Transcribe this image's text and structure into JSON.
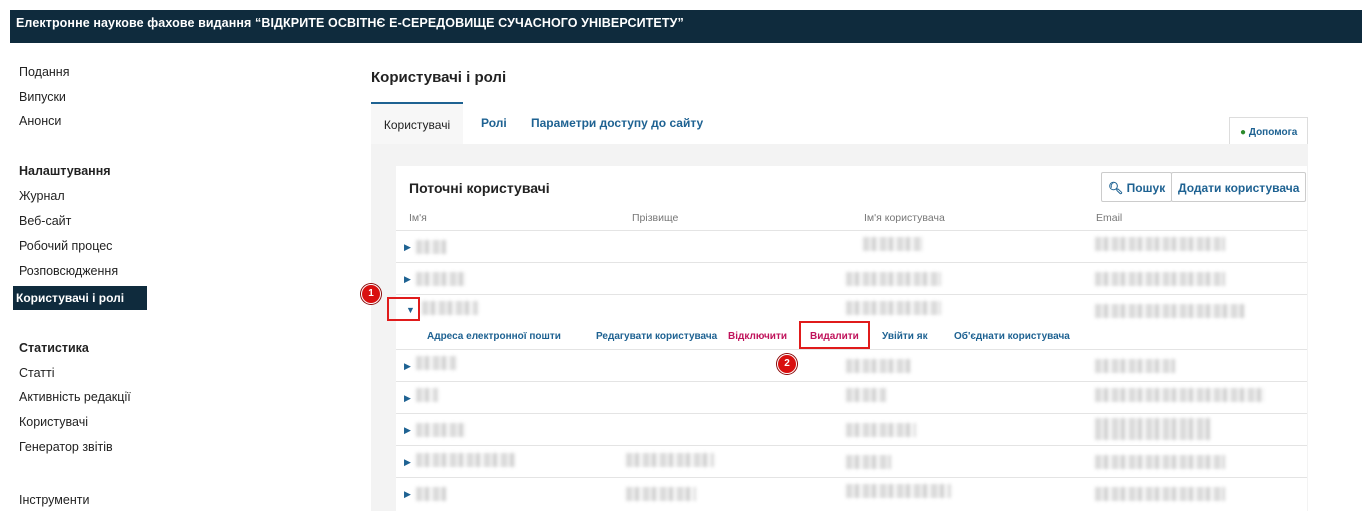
{
  "header": {
    "title": "Електронне наукове фахове видання “ВІДКРИТЕ ОСВІТНЄ Е-СЕРЕДОВИЩЕ СУЧАСНОГО УНІВЕРСИТЕТУ”"
  },
  "sidebar": {
    "group1": [
      "Подання",
      "Випуски",
      "Анонси"
    ],
    "settings_heading": "Налаштування",
    "settings": [
      "Журнал",
      "Веб-сайт",
      "Робочий процес",
      "Розповсюдження"
    ],
    "active_item": "Користувачі і ролі",
    "stats_heading": "Статистика",
    "stats": [
      "Статті",
      "Активність редакції",
      "Користувачі",
      "Генератор звітів"
    ],
    "tools": "Інструменти"
  },
  "page_title": "Користувачі і ролі",
  "tabs": [
    "Користувачі",
    "Ролі",
    "Параметри доступу до сайту"
  ],
  "help_label": "Допомога",
  "grid": {
    "title": "Поточні користувачі",
    "search_label": "Пошук",
    "add_user_label": "Додати користувача",
    "columns": [
      "Ім'я",
      "Прізвище",
      "Ім'я користувача",
      "Email"
    ]
  },
  "row_actions": [
    "Адреса електронної пошти",
    "Редагувати користувача",
    "Відключити",
    "Видалити",
    "Увійти як",
    "Об'єднати користувача"
  ],
  "annotations": [
    "1",
    "2"
  ],
  "colors": {
    "header_bg": "#0f2b3d",
    "link": "#1e6292",
    "danger": "#c0135b",
    "highlight": "#e01b1b"
  }
}
